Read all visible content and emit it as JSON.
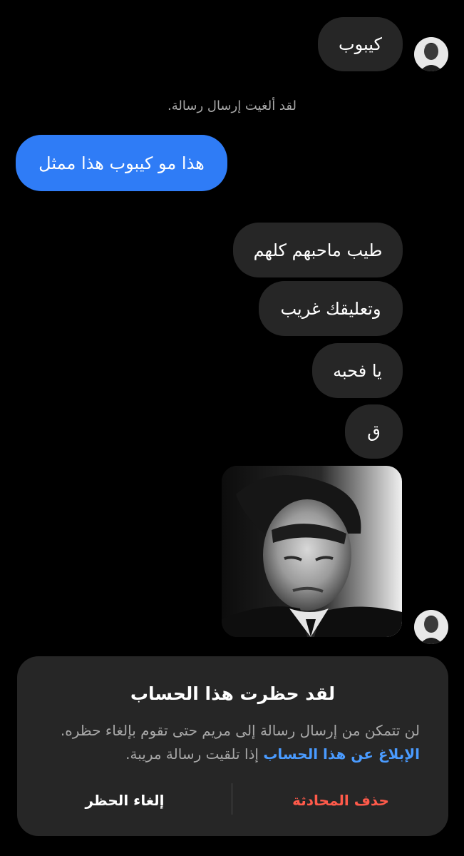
{
  "conversation": {
    "messages": [
      {
        "text": "كيبوب",
        "direction": "received"
      },
      {
        "text": "هذا مو كيبوب هذا ممثل",
        "direction": "sent"
      },
      {
        "text": "طيب ماحبهم كلهم",
        "direction": "received"
      },
      {
        "text": "وتعليقك غريب",
        "direction": "received"
      },
      {
        "text": "يا فحبه",
        "direction": "received"
      },
      {
        "text": "ق",
        "direction": "received"
      }
    ],
    "system_note": "لقد ألغيت إرسال رسالة."
  },
  "block_panel": {
    "title": "لقد حظرت هذا الحساب",
    "body_before": "لن تتمكن من إرسال رسالة إلى مريم حتى تقوم بإلغاء حظره. ",
    "report_link": "الإبلاغ عن هذا الحساب",
    "body_after": " إذا تلقيت رسالة مريبة.",
    "delete_label": "حذف المحادثة",
    "unblock_label": "إلغاء الحظر"
  },
  "colors": {
    "background": "#000000",
    "received_bubble": "#262626",
    "sent_bubble": "#2f7cf6",
    "link": "#4a9bff",
    "danger": "#ff5a4a"
  }
}
